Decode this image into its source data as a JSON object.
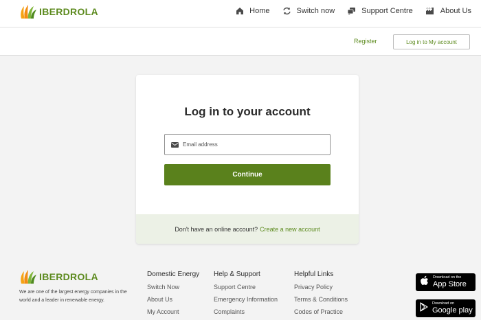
{
  "brand": {
    "name": "IBERDROLA",
    "color": "#5c8a1e"
  },
  "nav": {
    "items": [
      {
        "label": "Home",
        "icon": "home-icon"
      },
      {
        "label": "Switch now",
        "icon": "switch-icon"
      },
      {
        "label": "Support Centre",
        "icon": "support-icon"
      },
      {
        "label": "About Us",
        "icon": "factory-icon"
      }
    ]
  },
  "account": {
    "register_label": "Register",
    "login_label": "Log in to My account"
  },
  "login": {
    "title": "Log in to your account",
    "email_placeholder": "Email address",
    "email_value": "",
    "continue_label": "Continue",
    "no_account_text": "Don't have an online account?",
    "create_link": "Create a new account"
  },
  "footer": {
    "tagline": "We are one of the largest energy companies in the world and a leader in renewable energy.",
    "columns": [
      {
        "title": "Domestic Energy",
        "links": [
          "Switch Now",
          "About Us",
          "My Account"
        ]
      },
      {
        "title": "Help & Support",
        "links": [
          "Support Centre",
          "Emergency Information",
          "Complaints"
        ]
      },
      {
        "title": "Helpful Links",
        "links": [
          "Privacy Policy",
          "Terms & Conditions",
          "Codes of Practice"
        ]
      }
    ],
    "stores": {
      "apple": {
        "small": "Download on the",
        "big": "App Store"
      },
      "google": {
        "small": "Download on",
        "big": "Google play"
      }
    }
  },
  "colors": {
    "accent": "#5a811c",
    "card_footer_bg": "#ecf1e6",
    "page_bg": "#f3f3f3"
  }
}
